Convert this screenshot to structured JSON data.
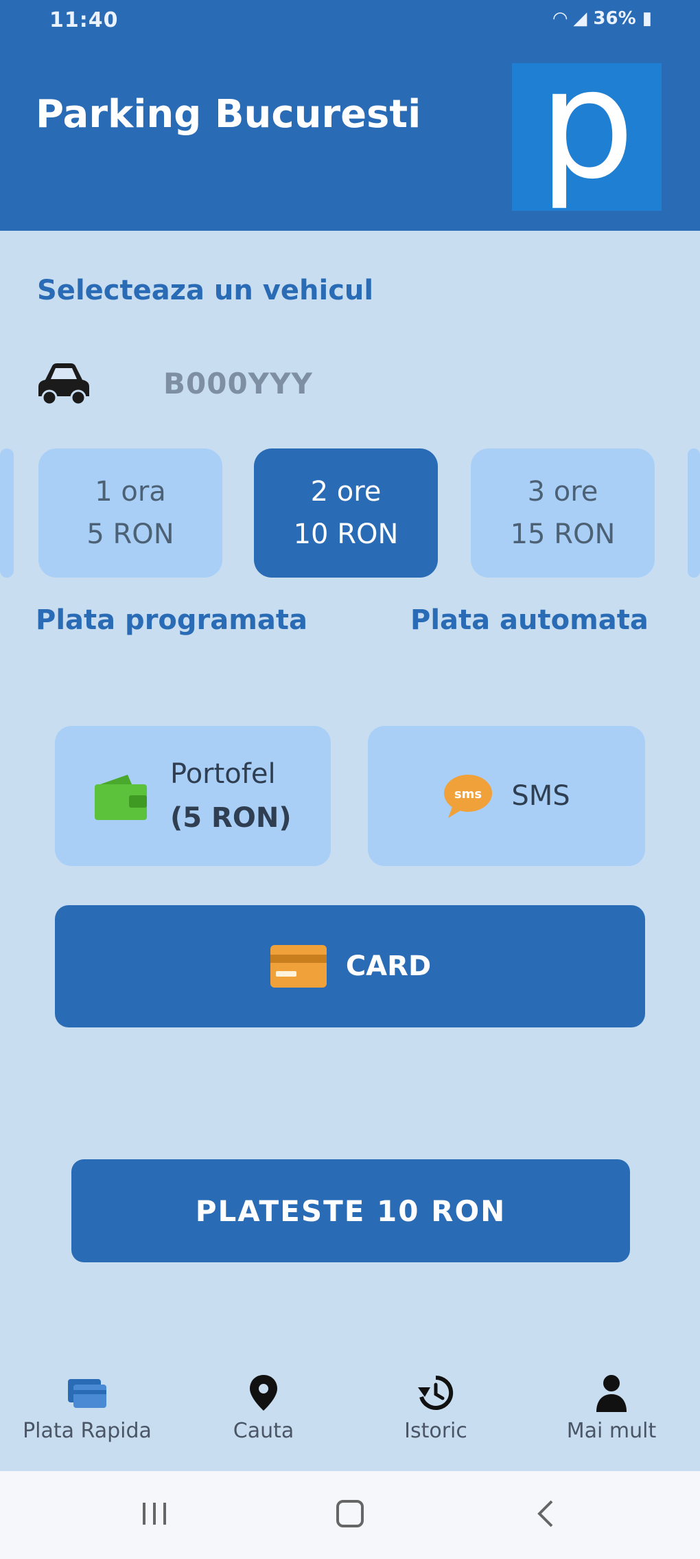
{
  "status": {
    "time": "11:40",
    "battery": "36%"
  },
  "header": {
    "title": "Parking Bucuresti",
    "logo_letter": "p"
  },
  "vehicle_section": {
    "title": "Selecteaza un vehicul",
    "plate": "B000YYY"
  },
  "durations": [
    {
      "hours": "1 ora",
      "price": "5 RON"
    },
    {
      "hours": "2 ore",
      "price": "10 RON"
    },
    {
      "hours": "3 ore",
      "price": "15 RON"
    }
  ],
  "plata": {
    "programata": "Plata programata",
    "automata": "Plata automata"
  },
  "payment_methods": {
    "wallet": {
      "label": "Portofel",
      "balance": "(5 RON)"
    },
    "sms": {
      "label": "SMS"
    },
    "card": {
      "label": "CARD"
    }
  },
  "pay_button": "PLATESTE 10 RON",
  "nav": [
    {
      "label": "Plata Rapida",
      "icon": "card-icon"
    },
    {
      "label": "Cauta",
      "icon": "location-pin-icon"
    },
    {
      "label": "Istoric",
      "icon": "history-icon"
    },
    {
      "label": "Mai mult",
      "icon": "person-icon"
    }
  ],
  "colors": {
    "primary": "#2a6bb5",
    "background": "#c9ddf1",
    "tile": "#a9cff7",
    "wallet": "#5cc13b",
    "sms": "#f0a13a"
  }
}
